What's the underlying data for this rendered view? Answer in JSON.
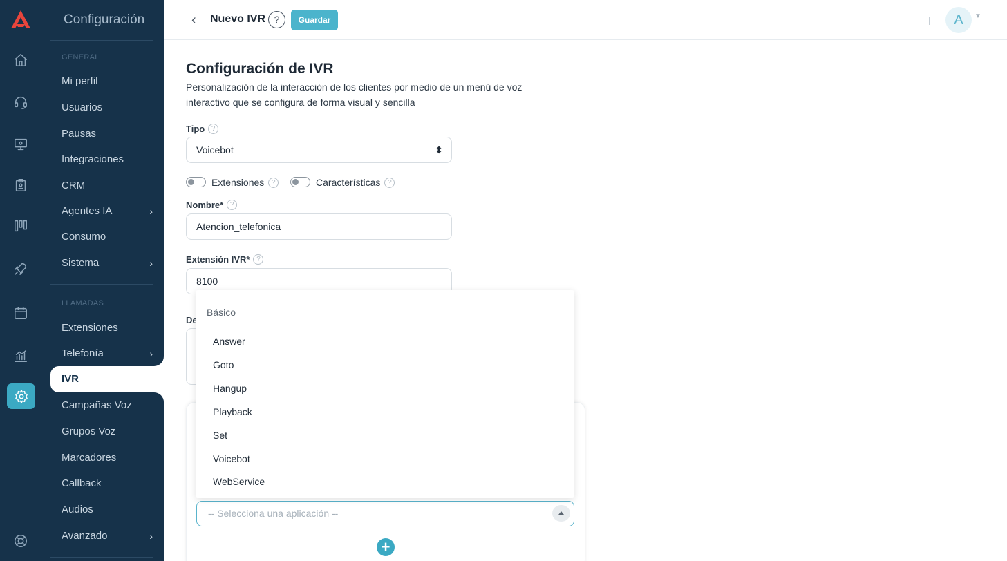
{
  "app": {
    "section_title": "Configuración",
    "accent": "#3ba9c3",
    "sidebar_bg": "#16324a"
  },
  "rail": {
    "icons": [
      "logo-icon",
      "home-icon",
      "headset-icon",
      "monitor-icon",
      "badge-icon",
      "kanban-icon",
      "rocket-icon",
      "calendar-icon",
      "chart-icon",
      "settings-icon",
      "lifebuoy-icon"
    ]
  },
  "sidebar": {
    "general_section": "GENERAL",
    "general_items": [
      {
        "label": "Mi perfil"
      },
      {
        "label": "Usuarios"
      },
      {
        "label": "Pausas"
      },
      {
        "label": "Integraciones"
      },
      {
        "label": "CRM"
      },
      {
        "label": "Agentes IA",
        "chevron": "›"
      },
      {
        "label": "Consumo"
      },
      {
        "label": "Sistema",
        "chevron": "›"
      }
    ],
    "calls_section": "LLAMADAS",
    "calls_items": [
      {
        "label": "Extensiones"
      },
      {
        "label": "Telefonía",
        "chevron": "›"
      },
      {
        "label": "IVR",
        "active": true
      },
      {
        "label": "Campañas Voz"
      },
      {
        "label": "Grupos Voz"
      },
      {
        "label": "Marcadores"
      },
      {
        "label": "Callback"
      },
      {
        "label": "Audios"
      },
      {
        "label": "Avanzado",
        "chevron": "›"
      }
    ]
  },
  "header": {
    "back": "‹",
    "title": "Nuevo IVR",
    "help": "?",
    "save_label": "Guardar",
    "avatar_initial": "A"
  },
  "form": {
    "heading": "Configuración de IVR",
    "description": "Personalización de la interacción de los clientes por medio de un menú de voz interactivo que se configura de forma visual y sencilla",
    "tipo_label": "Tipo",
    "tipo_value": "Voicebot",
    "extensiones_label": "Extensiones",
    "caracteristicas_label": "Características",
    "nombre_label": "Nombre*",
    "nombre_value": "Atencion_telefonica",
    "extension_label": "Extensión IVR*",
    "extension_value": "8100",
    "partial_label": "De",
    "app_placeholder": "-- Selecciona una aplicación --",
    "add": "+"
  },
  "dropdown": {
    "group": "Básico",
    "options": [
      "Answer",
      "Goto",
      "Hangup",
      "Playback",
      "Set",
      "Voicebot",
      "WebService"
    ]
  }
}
